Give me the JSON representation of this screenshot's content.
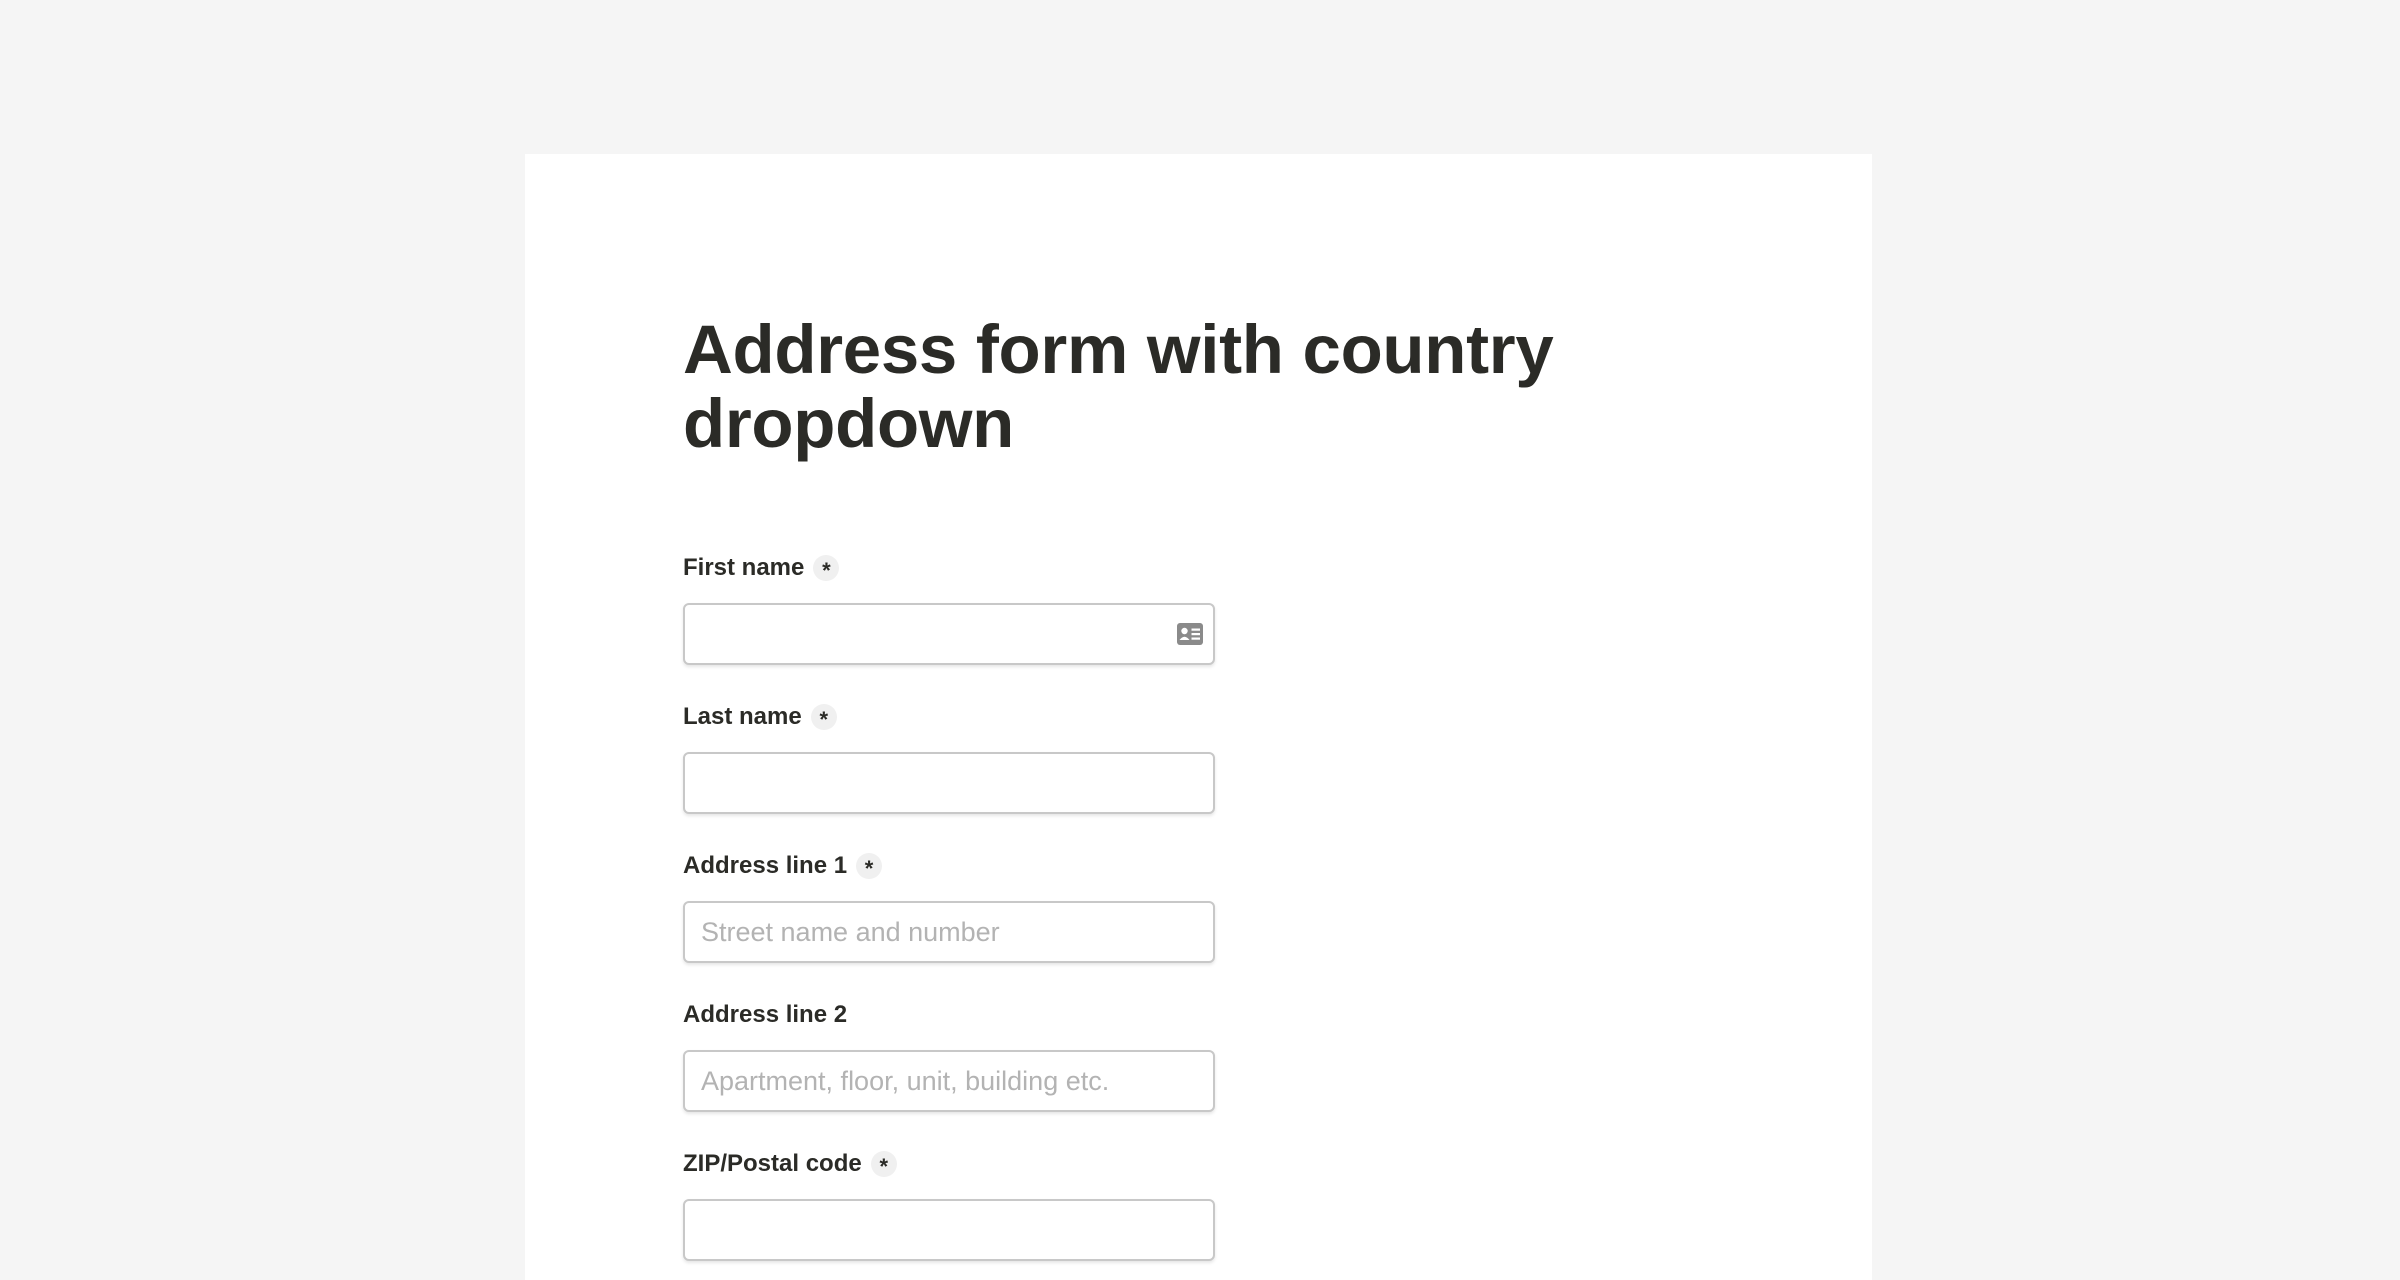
{
  "page": {
    "title": "Address form with country dropdown"
  },
  "form": {
    "required_marker": "*",
    "fields": {
      "first_name": {
        "label": "First name",
        "value": "",
        "placeholder": "",
        "required": true
      },
      "last_name": {
        "label": "Last name",
        "value": "",
        "placeholder": "",
        "required": true
      },
      "address_line_1": {
        "label": "Address line 1",
        "value": "",
        "placeholder": "Street name and number",
        "required": true
      },
      "address_line_2": {
        "label": "Address line 2",
        "value": "",
        "placeholder": "Apartment, floor, unit, building etc.",
        "required": false
      },
      "zip": {
        "label": "ZIP/Postal code",
        "value": "",
        "placeholder": "",
        "required": true
      }
    }
  },
  "icons": {
    "autofill": "contact-card-icon"
  },
  "colors": {
    "page_background": "#f5f5f5",
    "card_background": "#ffffff",
    "text": "#2b2b27",
    "input_border": "#c8c8c8",
    "placeholder": "#b3b3b3"
  }
}
